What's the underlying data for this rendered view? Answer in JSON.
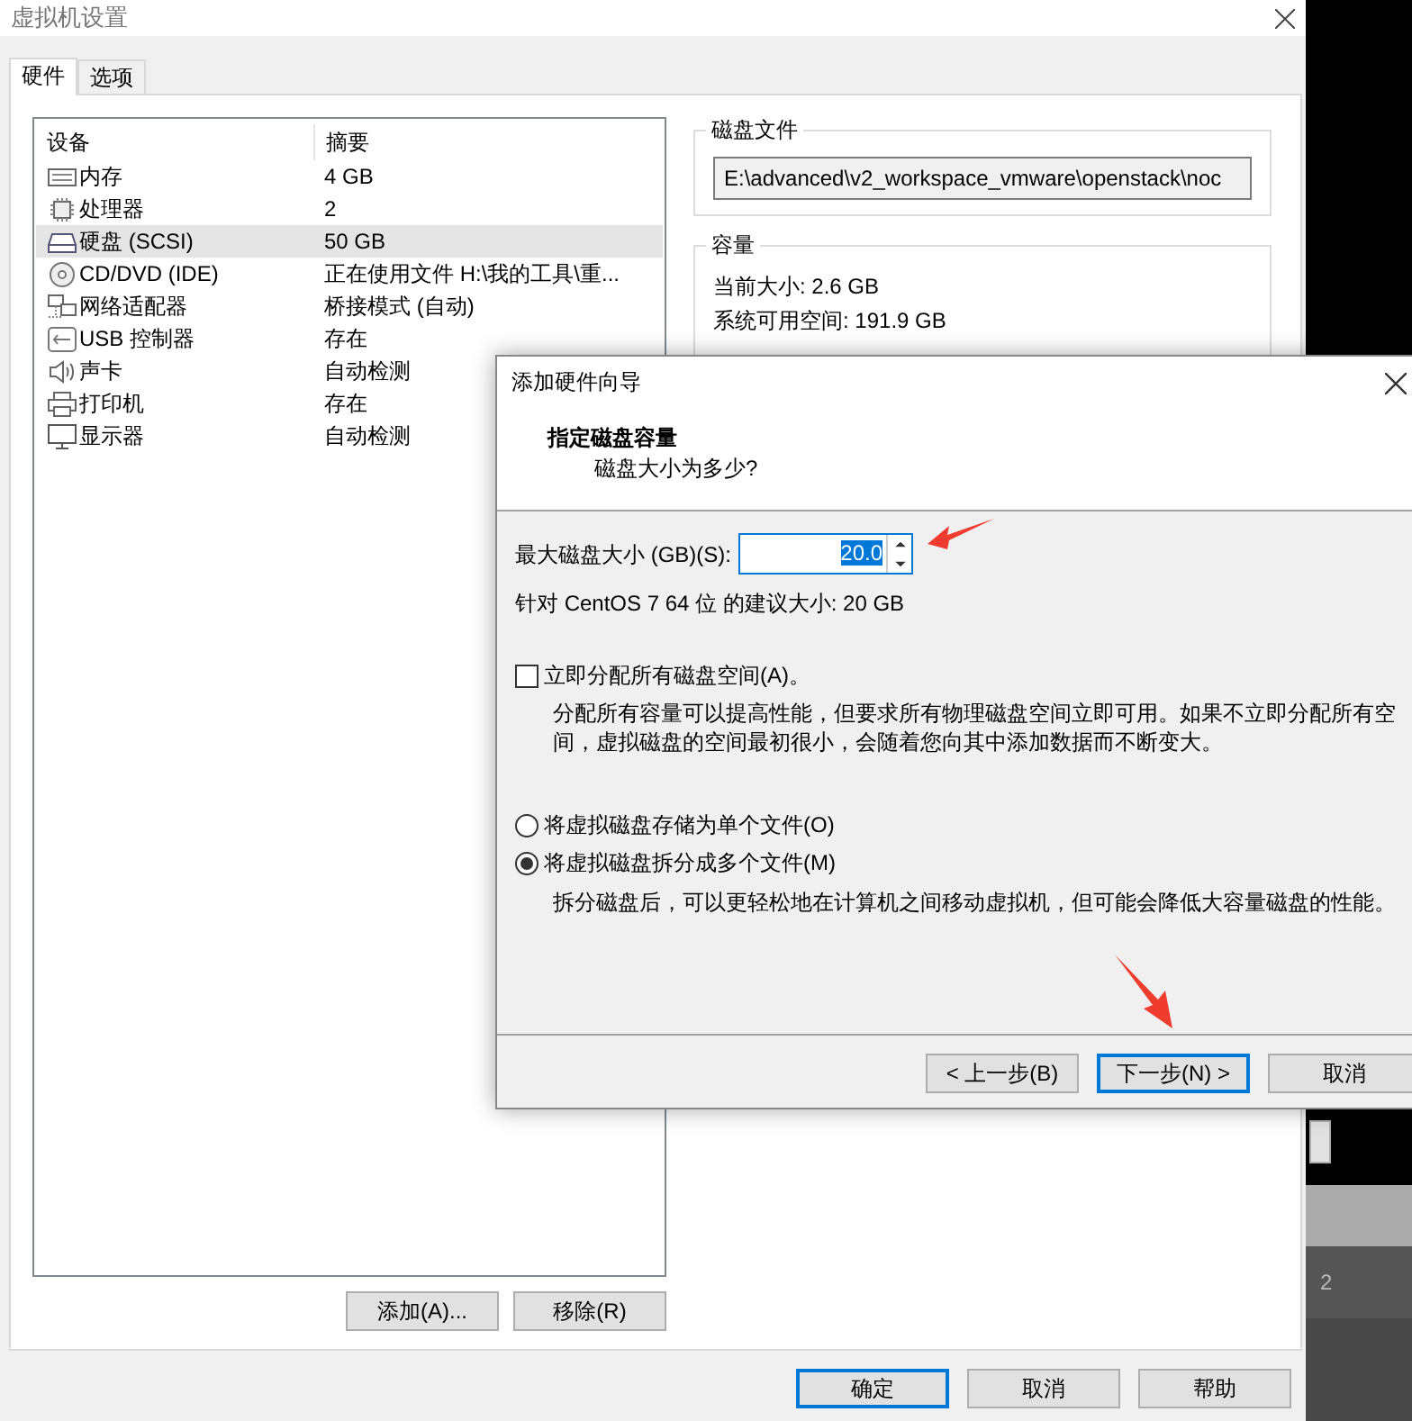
{
  "window": {
    "title": "虚拟机设置"
  },
  "tabs": [
    {
      "label": "硬件",
      "selected": true
    },
    {
      "label": "选项",
      "selected": false
    }
  ],
  "devices": {
    "columns": [
      "设备",
      "摘要"
    ],
    "rows": [
      {
        "kind": "memory",
        "name": "内存",
        "summary": "4 GB",
        "selected": false
      },
      {
        "kind": "cpu",
        "name": "处理器",
        "summary": "2",
        "selected": false
      },
      {
        "kind": "disk",
        "name": "硬盘 (SCSI)",
        "summary": "50 GB",
        "selected": true
      },
      {
        "kind": "cd",
        "name": "CD/DVD (IDE)",
        "summary": "正在使用文件 H:\\我的工具\\重...",
        "selected": false
      },
      {
        "kind": "network",
        "name": "网络适配器",
        "summary": "桥接模式 (自动)",
        "selected": false
      },
      {
        "kind": "usb",
        "name": "USB 控制器",
        "summary": "存在",
        "selected": false
      },
      {
        "kind": "sound",
        "name": "声卡",
        "summary": "自动检测",
        "selected": false
      },
      {
        "kind": "printer",
        "name": "打印机",
        "summary": "存在",
        "selected": false
      },
      {
        "kind": "display",
        "name": "显示器",
        "summary": "自动检测",
        "selected": false
      }
    ]
  },
  "device_buttons": [
    "添加(A)...",
    "移除(R)"
  ],
  "disk_file": {
    "title": "磁盘文件",
    "value": "E:\\advanced\\v2_workspace_vmware\\openstack\\noc"
  },
  "capacity": {
    "title": "容量",
    "lines": [
      "当前大小: 2.6 GB",
      "系统可用空间: 191.9 GB"
    ]
  },
  "footer_buttons": [
    {
      "label": "确定",
      "default": true
    },
    {
      "label": "取消",
      "default": false
    },
    {
      "label": "帮助",
      "default": false
    }
  ],
  "background": {
    "label": "2"
  },
  "wizard": {
    "title": "添加硬件向导",
    "heading": "指定磁盘容量",
    "subheading": "磁盘大小为多少?",
    "size_label": "最大磁盘大小 (GB)(S):",
    "size_value": "20.0",
    "size_value_selected": true,
    "recommendation": "针对 CentOS 7 64 位 的建议大小: 20 GB",
    "allocate": {
      "label": "立即分配所有磁盘空间(A)。",
      "checked": false,
      "description": "分配所有容量可以提高性能，但要求所有物理磁盘空间立即可用。如果不立即分配所有空间，虚拟磁盘的空间最初很小，会随着您向其中添加数据而不断变大。"
    },
    "storage_options": [
      {
        "label": "将虚拟磁盘存储为单个文件(O)",
        "selected": false
      },
      {
        "label": "将虚拟磁盘拆分成多个文件(M)",
        "selected": true
      }
    ],
    "split_description": "拆分磁盘后，可以更轻松地在计算机之间移动虚拟机，但可能会降低大容量磁盘的性能。",
    "buttons": [
      {
        "label": "< 上一步(B)",
        "default": false
      },
      {
        "label": "下一步(N) >",
        "default": true
      },
      {
        "label": "取消",
        "default": false
      }
    ]
  }
}
